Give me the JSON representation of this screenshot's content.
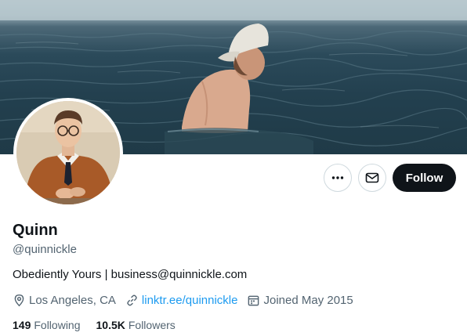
{
  "profile": {
    "name": "Quinn",
    "handle": "@quinnickle",
    "bio": "Obediently Yours | business@quinnickle.com",
    "location": "Los Angeles, CA",
    "link": "linktr.ee/quinnickle",
    "joined": "Joined May 2015"
  },
  "stats": {
    "following_count": "149",
    "following_label": "Following",
    "followers_count": "10.5K",
    "followers_label": "Followers"
  },
  "actions": {
    "more_icon": "more-dots-icon",
    "message_icon": "envelope-icon",
    "follow_label": "Follow"
  },
  "colors": {
    "accent_link": "#1d9bf0",
    "follow_bg": "#0f1419",
    "secondary_text": "#536471"
  }
}
